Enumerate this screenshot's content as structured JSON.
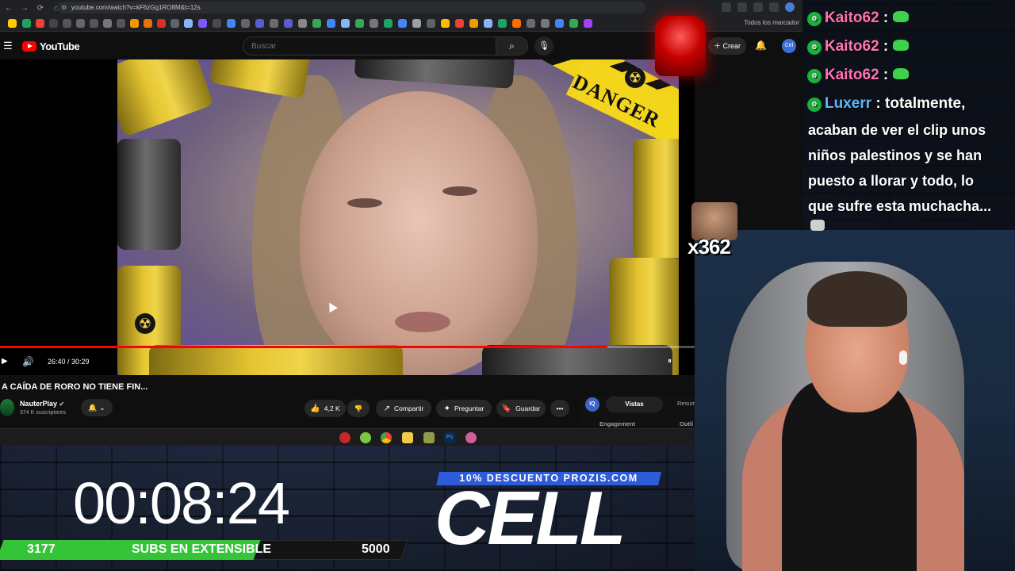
{
  "browser": {
    "url": "youtube.com/watch?v=kF6zGg1RO8M&t=12s",
    "bookmarks_label": "Todos los marcador"
  },
  "youtube": {
    "logo_text": "YouTube",
    "search_placeholder": "Buscar",
    "create_label": "Crear",
    "avatar_text": "Cel"
  },
  "video": {
    "time_current": "26:40",
    "time_total": "30:29",
    "time_display": "26:40 / 30:29",
    "progress_fraction": 0.8746,
    "overlay_text": "DANGER",
    "title": "A CAÍDA DE RORO NO TIENE FIN...",
    "channel_name": "NauterPlay",
    "channel_subs": "374 K suscriptores",
    "likes": "4,2 K",
    "share_label": "Compartir",
    "ask_label": "Preguntar",
    "save_label": "Guardar"
  },
  "engagement_panel": {
    "iq_label": "IQ",
    "tab_active": "Vistas",
    "tab_other": "Resum",
    "label_left": "Engagement",
    "label_right": "Outli"
  },
  "chat": {
    "messages": [
      {
        "user": "Kaito62",
        "text": ":"
      },
      {
        "user": "Kaito62",
        "text": ":"
      },
      {
        "user": "Kaito62",
        "text": ":"
      },
      {
        "user": "Luxerr",
        "text": ": totalmente,"
      }
    ],
    "luxerr_lines": [
      "acaban de ver el clip unos",
      "niños palestinos y se han",
      "puesto a llorar y todo, lo",
      "que sufre esta muchacha..."
    ]
  },
  "emote_combo": "x362",
  "stream_overlay": {
    "timer": "00:08:24",
    "subs_current": "3177",
    "subs_label": "SUBS EN EXTENSIBLE",
    "subs_goal": "5000",
    "subs_fraction": 0.6354,
    "promo_text": "10% DESCUENTO PROZIS.COM",
    "promo_brand": "CELL"
  },
  "colors": {
    "chat_kaito": "#ff74b0",
    "chat_luxerr": "#5fb7ff",
    "subs_green": "#35c437",
    "promo_blue": "#2e5bd8",
    "yt_red": "#ff0000"
  }
}
